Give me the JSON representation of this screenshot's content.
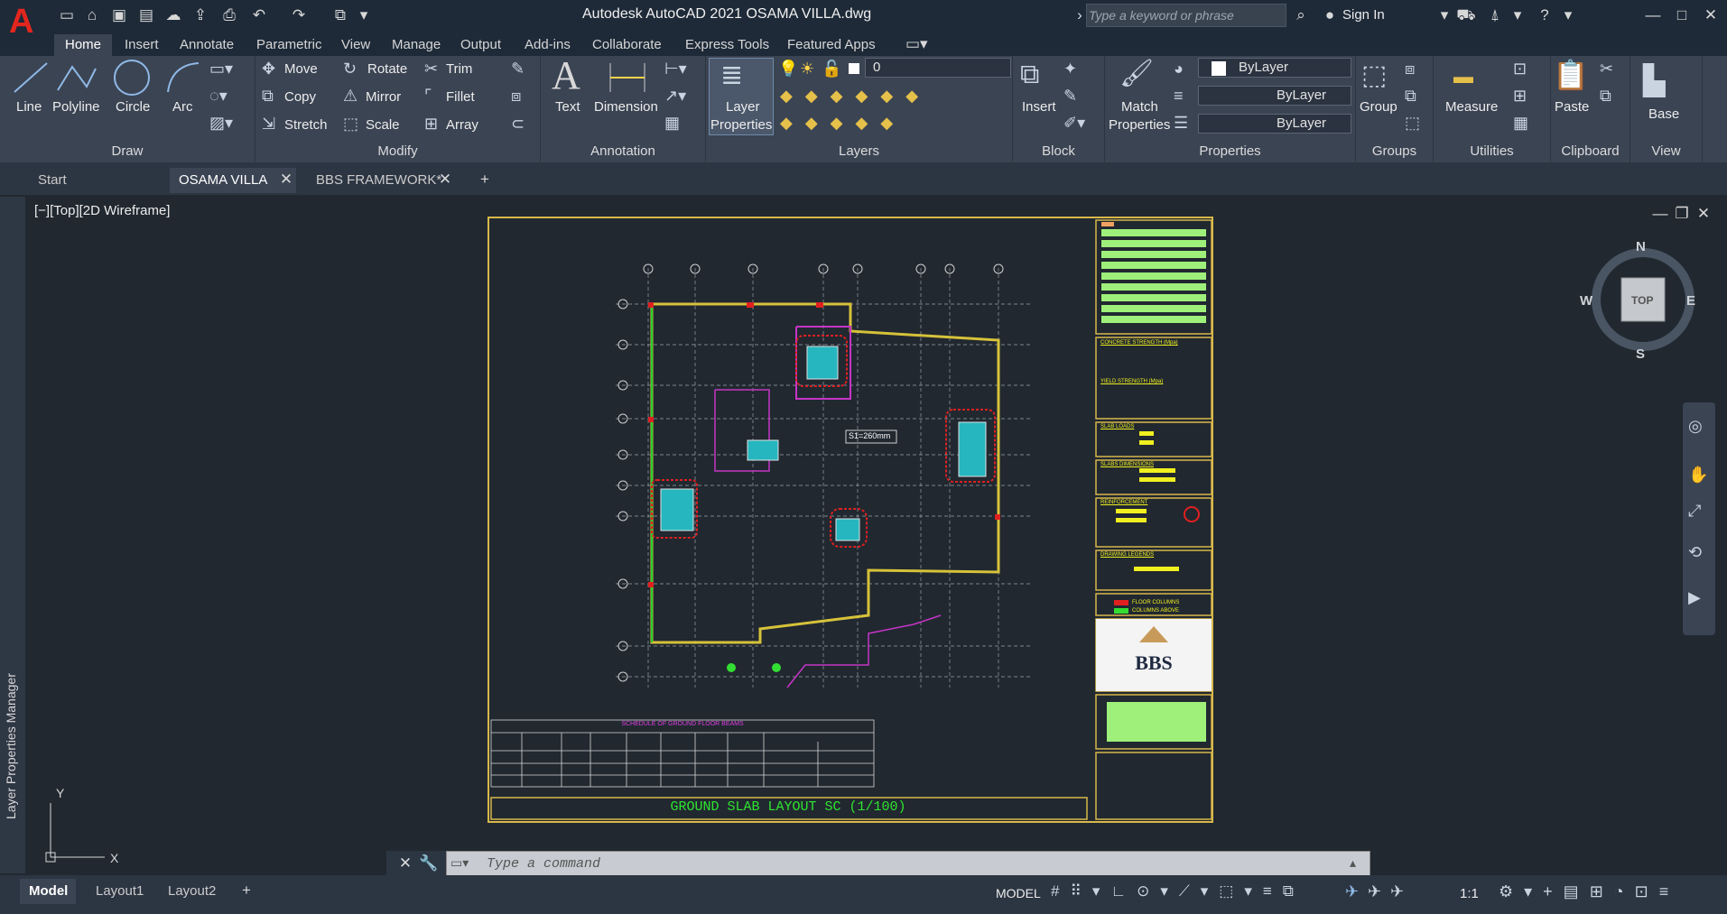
{
  "app": {
    "title": "Autodesk AutoCAD 2021    OSAMA VILLA.dwg",
    "logo": "A",
    "search_placeholder": "Type a keyword or phrase",
    "signin": "Sign In"
  },
  "menu_tabs": [
    "Home",
    "Insert",
    "Annotate",
    "Parametric",
    "View",
    "Manage",
    "Output",
    "Add-ins",
    "Collaborate",
    "Express Tools",
    "Featured Apps"
  ],
  "ribbon": {
    "draw": {
      "title": "Draw",
      "line": "Line",
      "polyline": "Polyline",
      "circle": "Circle",
      "arc": "Arc"
    },
    "modify": {
      "title": "Modify",
      "move": "Move",
      "rotate": "Rotate",
      "trim": "Trim",
      "copy": "Copy",
      "mirror": "Mirror",
      "fillet": "Fillet",
      "stretch": "Stretch",
      "scale": "Scale",
      "array": "Array"
    },
    "annotation": {
      "title": "Annotation",
      "text": "Text",
      "dimension": "Dimension"
    },
    "layers": {
      "title": "Layers",
      "layer_props_1": "Layer",
      "layer_props_2": "Properties",
      "current_layer": "0"
    },
    "block": {
      "title": "Block",
      "insert": "Insert"
    },
    "properties": {
      "title": "Properties",
      "match1": "Match",
      "match2": "Properties",
      "color": "ByLayer",
      "linetype": "ByLayer",
      "lineweight": "ByLayer"
    },
    "groups": {
      "title": "Groups",
      "group": "Group"
    },
    "utilities": {
      "title": "Utilities",
      "measure": "Measure"
    },
    "clipboard": {
      "title": "Clipboard",
      "paste": "Paste"
    },
    "view": {
      "title": "View",
      "base": "Base"
    }
  },
  "doc_tabs": [
    "Start",
    "OSAMA VILLA",
    "BBS FRAMEWORK*"
  ],
  "viewport": {
    "label": "[−][Top][2D Wireframe]",
    "side_panel": "Layer Properties Manager"
  },
  "viewcube": {
    "n": "N",
    "s": "S",
    "e": "E",
    "w": "W",
    "top": "TOP"
  },
  "drawing": {
    "title": "GROUND SLAB LAYOUT SC (1/100)",
    "schedule_title": "SCHEDULE OF GROUND FLOOR BEAMS",
    "slab_note": "S1=260mm",
    "legend": {
      "concrete": "CONCRETE STRENGTH (Mpa)",
      "yield": "YIELD STRENGTH (Mpa)",
      "slab_loads": "SLAB LOADS",
      "slab_dims": "SLABS DIMENSIONS",
      "reinf": "REINFORCEMENT",
      "drawing_legends": "DRAWING LEGENDS",
      "floor_cols": "FLOOR COLUMNS",
      "cols_above": "COLUMNS ABOVE"
    },
    "logo": "BBS"
  },
  "command": {
    "placeholder": "Type a command"
  },
  "layouts": [
    "Model",
    "Layout1",
    "Layout2"
  ],
  "status": {
    "model": "MODEL",
    "scale": "1:1"
  }
}
